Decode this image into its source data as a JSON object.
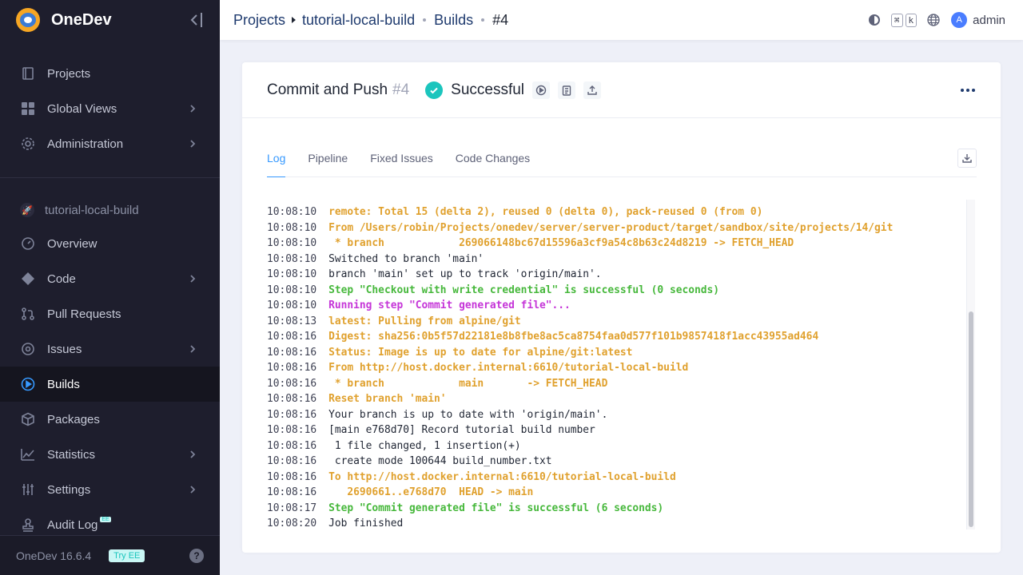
{
  "brand": {
    "name": "OneDev"
  },
  "sidebar": {
    "items": [
      {
        "label": "Projects",
        "icon": "projects-icon"
      },
      {
        "label": "Global Views",
        "icon": "grid-icon"
      },
      {
        "label": "Administration",
        "icon": "gear-icon"
      }
    ],
    "project": {
      "name": "tutorial-local-build",
      "icon": "rocket-icon"
    },
    "project_items": [
      {
        "label": "Overview",
        "icon": "dashboard-icon"
      },
      {
        "label": "Code",
        "icon": "code-icon"
      },
      {
        "label": "Pull Requests",
        "icon": "pull-request-icon"
      },
      {
        "label": "Issues",
        "icon": "issues-icon"
      },
      {
        "label": "Builds",
        "icon": "builds-icon",
        "active": true
      },
      {
        "label": "Packages",
        "icon": "package-icon"
      },
      {
        "label": "Statistics",
        "icon": "chart-icon"
      },
      {
        "label": "Settings",
        "icon": "sliders-icon"
      },
      {
        "label": "Audit Log",
        "icon": "stamp-icon",
        "badge": "EE"
      }
    ],
    "footer": {
      "version": "OneDev 16.6.4",
      "try_ee": "Try EE"
    }
  },
  "topbar": {
    "breadcrumbs": [
      "Projects",
      "tutorial-local-build",
      "Builds",
      "#4"
    ],
    "shortcut_keys": [
      "⌘",
      "k"
    ],
    "avatar_letter": "A",
    "user": "admin"
  },
  "build": {
    "title": "Commit and Push",
    "number": "#4",
    "status": "Successful",
    "status_color": "#1bc5bd"
  },
  "tabs": [
    "Log",
    "Pipeline",
    "Fixed Issues",
    "Code Changes"
  ],
  "log": [
    {
      "time": "10:08:10",
      "msg": "remote: Total 15 (delta 2), reused 0 (delta 0), pack-reused 0 (from 0)",
      "style": "orange"
    },
    {
      "time": "10:08:10",
      "msg": "From /Users/robin/Projects/onedev/server/server-product/target/sandbox/site/projects/14/git",
      "style": "orange"
    },
    {
      "time": "10:08:10",
      "msg": " * branch            269066148bc67d15596a3cf9a54c8b63c24d8219 -> FETCH_HEAD",
      "style": "orange"
    },
    {
      "time": "10:08:10",
      "msg": "Switched to branch 'main'",
      "style": "plain"
    },
    {
      "time": "10:08:10",
      "msg": "branch 'main' set up to track 'origin/main'.",
      "style": "plain"
    },
    {
      "time": "10:08:10",
      "msg": "Step \"Checkout with write credential\" is successful (0 seconds)",
      "style": "green"
    },
    {
      "time": "10:08:10",
      "msg": "Running step \"Commit generated file\"...",
      "style": "purple"
    },
    {
      "time": "10:08:13",
      "msg": "latest: Pulling from alpine/git",
      "style": "orange"
    },
    {
      "time": "10:08:16",
      "msg": "Digest: sha256:0b5f57d22181e8b8fbe8ac5ca8754faa0d577f101b9857418f1acc43955ad464",
      "style": "orange"
    },
    {
      "time": "10:08:16",
      "msg": "Status: Image is up to date for alpine/git:latest",
      "style": "orange"
    },
    {
      "time": "10:08:16",
      "msg": "From http://host.docker.internal:6610/tutorial-local-build",
      "style": "orange"
    },
    {
      "time": "10:08:16",
      "msg": " * branch            main       -> FETCH_HEAD",
      "style": "orange"
    },
    {
      "time": "10:08:16",
      "msg": "Reset branch 'main'",
      "style": "orange"
    },
    {
      "time": "10:08:16",
      "msg": "Your branch is up to date with 'origin/main'.",
      "style": "plain"
    },
    {
      "time": "10:08:16",
      "msg": "[main e768d70] Record tutorial build number",
      "style": "plain"
    },
    {
      "time": "10:08:16",
      "msg": " 1 file changed, 1 insertion(+)",
      "style": "plain"
    },
    {
      "time": "10:08:16",
      "msg": " create mode 100644 build_number.txt",
      "style": "plain"
    },
    {
      "time": "10:08:16",
      "msg": "To http://host.docker.internal:6610/tutorial-local-build",
      "style": "orange"
    },
    {
      "time": "10:08:16",
      "msg": "   2690661..e768d70  HEAD -> main",
      "style": "orange"
    },
    {
      "time": "10:08:17",
      "msg": "Step \"Commit generated file\" is successful (6 seconds)",
      "style": "green"
    },
    {
      "time": "10:08:20",
      "msg": "Job finished",
      "style": "plain"
    }
  ]
}
